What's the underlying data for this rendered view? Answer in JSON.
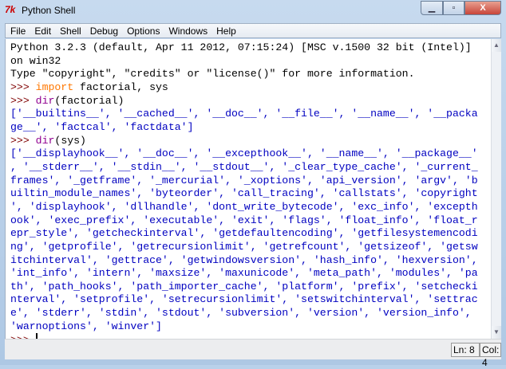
{
  "window": {
    "title": "Python Shell",
    "app_icon": "7k",
    "minimize_glyph": "▁",
    "maximize_glyph": "▫",
    "close_glyph": "X"
  },
  "menu": [
    "File",
    "Edit",
    "Shell",
    "Debug",
    "Options",
    "Windows",
    "Help"
  ],
  "lines": [
    [
      {
        "t": "Python 3.2.3 (default, Apr 11 2012, 07:15:24) [MSC v.1500 32 bit (Intel)]",
        "c": ""
      }
    ],
    [
      {
        "t": "on win32",
        "c": ""
      }
    ],
    [
      {
        "t": "Type \"copyright\", \"credits\" or \"license()\" for more information.",
        "c": ""
      }
    ],
    [
      {
        "t": ">>> ",
        "c": "prompt"
      },
      {
        "t": "import",
        "c": "kw"
      },
      {
        "t": " factorial, sys",
        "c": ""
      }
    ],
    [
      {
        "t": ">>> ",
        "c": "prompt"
      },
      {
        "t": "dir",
        "c": "builtin"
      },
      {
        "t": "(factorial)",
        "c": ""
      }
    ],
    [
      {
        "t": "['__builtins__', '__cached__', '__doc__', '__file__', '__name__', '__packa",
        "c": "out"
      }
    ],
    [
      {
        "t": "ge__', 'factcal', 'factdata']",
        "c": "out"
      }
    ],
    [
      {
        "t": ">>> ",
        "c": "prompt"
      },
      {
        "t": "dir",
        "c": "builtin"
      },
      {
        "t": "(sys)",
        "c": ""
      }
    ],
    [
      {
        "t": "['__displayhook__', '__doc__', '__excepthook__', '__name__', '__package__'",
        "c": "out"
      }
    ],
    [
      {
        "t": ", '__stderr__', '__stdin__', '__stdout__', '_clear_type_cache', '_current_",
        "c": "out"
      }
    ],
    [
      {
        "t": "frames', '_getframe', '_mercurial', '_xoptions', 'api_version', 'argv', 'b",
        "c": "out"
      }
    ],
    [
      {
        "t": "uiltin_module_names', 'byteorder', 'call_tracing', 'callstats', 'copyright",
        "c": "out"
      }
    ],
    [
      {
        "t": "', 'displayhook', 'dllhandle', 'dont_write_bytecode', 'exc_info', 'excepth",
        "c": "out"
      }
    ],
    [
      {
        "t": "ook', 'exec_prefix', 'executable', 'exit', 'flags', 'float_info', 'float_r",
        "c": "out"
      }
    ],
    [
      {
        "t": "epr_style', 'getcheckinterval', 'getdefaultencoding', 'getfilesystemencodi",
        "c": "out"
      }
    ],
    [
      {
        "t": "ng', 'getprofile', 'getrecursionlimit', 'getrefcount', 'getsizeof', 'getsw",
        "c": "out"
      }
    ],
    [
      {
        "t": "itchinterval', 'gettrace', 'getwindowsversion', 'hash_info', 'hexversion',",
        "c": "out"
      }
    ],
    [
      {
        "t": "'int_info', 'intern', 'maxsize', 'maxunicode', 'meta_path', 'modules', 'pa",
        "c": "out"
      }
    ],
    [
      {
        "t": "th', 'path_hooks', 'path_importer_cache', 'platform', 'prefix', 'setchecki",
        "c": "out"
      }
    ],
    [
      {
        "t": "nterval', 'setprofile', 'setrecursionlimit', 'setswitchinterval', 'settrac",
        "c": "out"
      }
    ],
    [
      {
        "t": "e', 'stderr', 'stdin', 'stdout', 'subversion', 'version', 'version_info',",
        "c": "out"
      }
    ],
    [
      {
        "t": "'warnoptions', 'winver']",
        "c": "out"
      }
    ]
  ],
  "current_prompt": ">>> ",
  "status": {
    "line": "Ln: 8",
    "col": "Col: 4"
  },
  "scrollbar": {
    "up": "▲",
    "down": "▼"
  }
}
